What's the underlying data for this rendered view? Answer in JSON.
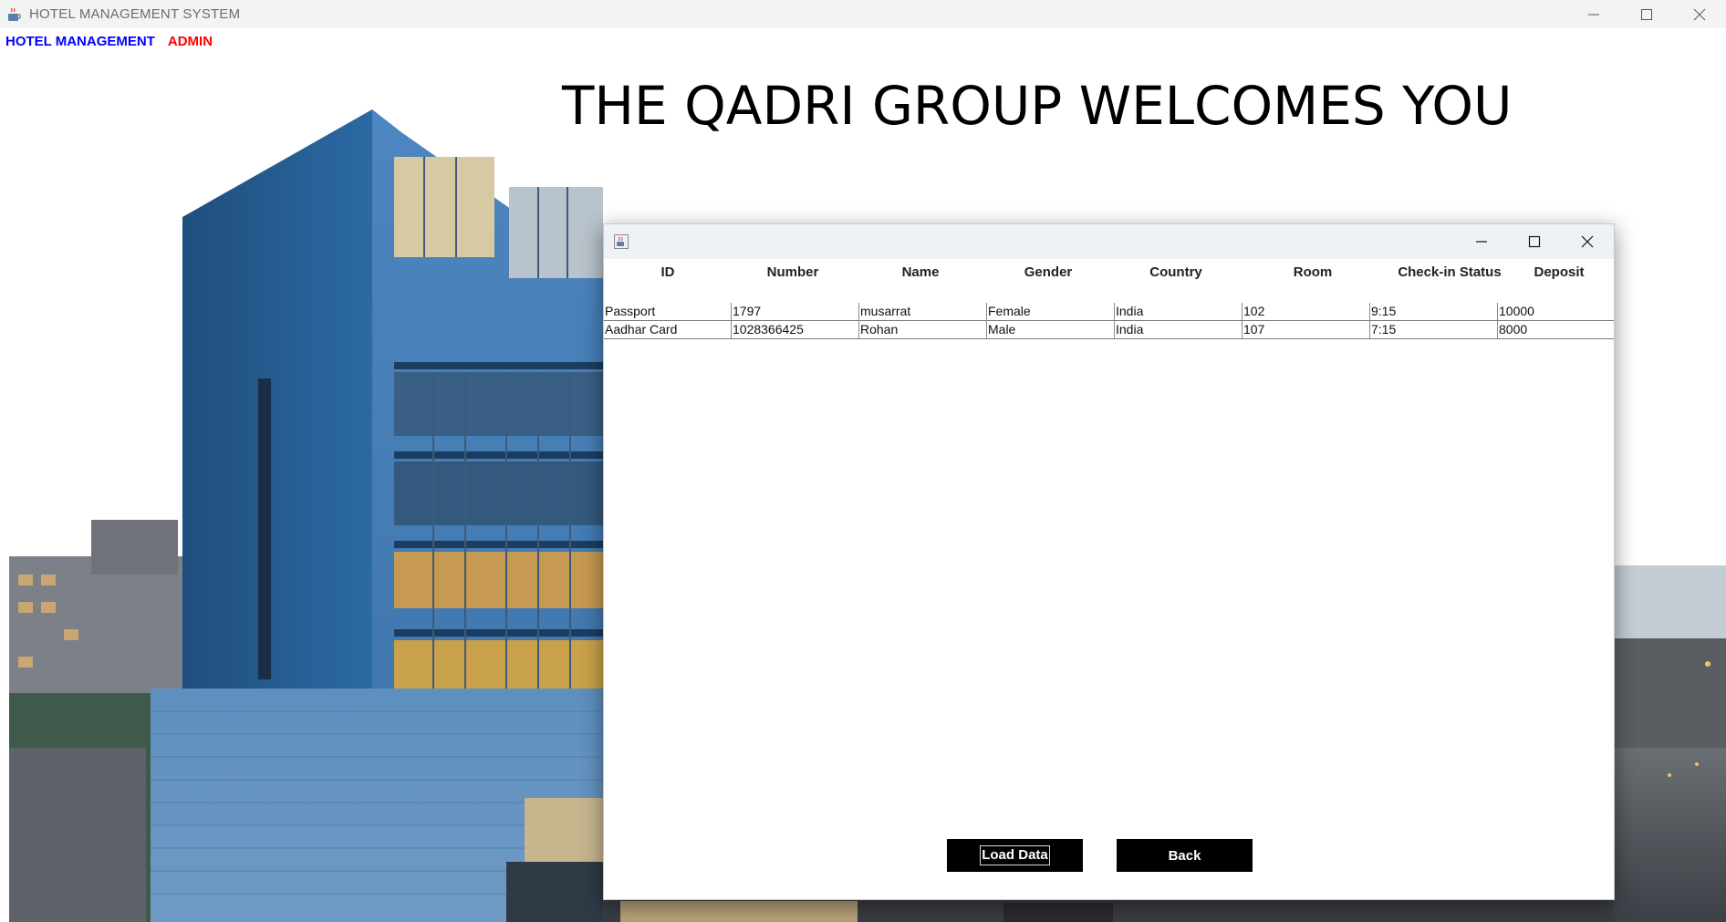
{
  "window": {
    "title": "HOTEL MANAGEMENT SYSTEM",
    "icon": "java-coffee-icon"
  },
  "menu": {
    "items": [
      {
        "label": "HOTEL MANAGEMENT",
        "color": "#0000ff"
      },
      {
        "label": "ADMIN",
        "color": "#ff0000"
      }
    ]
  },
  "welcome_text": "THE QADRI GROUP WELCOMES YOU",
  "dialog": {
    "icon": "java-coffee-icon",
    "columns": [
      "ID",
      "Number",
      "Name",
      "Gender",
      "Country",
      "Room",
      "Check-in Status",
      "Deposit"
    ],
    "rows": [
      [
        "Passport",
        "1797",
        "musarrat",
        "Female",
        "India",
        "102",
        "9:15",
        "10000"
      ],
      [
        "Aadhar Card",
        "1028366425",
        "Rohan",
        "Male",
        "India",
        "107",
        "7:15",
        "8000"
      ]
    ],
    "load_button": "Load Data",
    "back_button": "Back"
  }
}
